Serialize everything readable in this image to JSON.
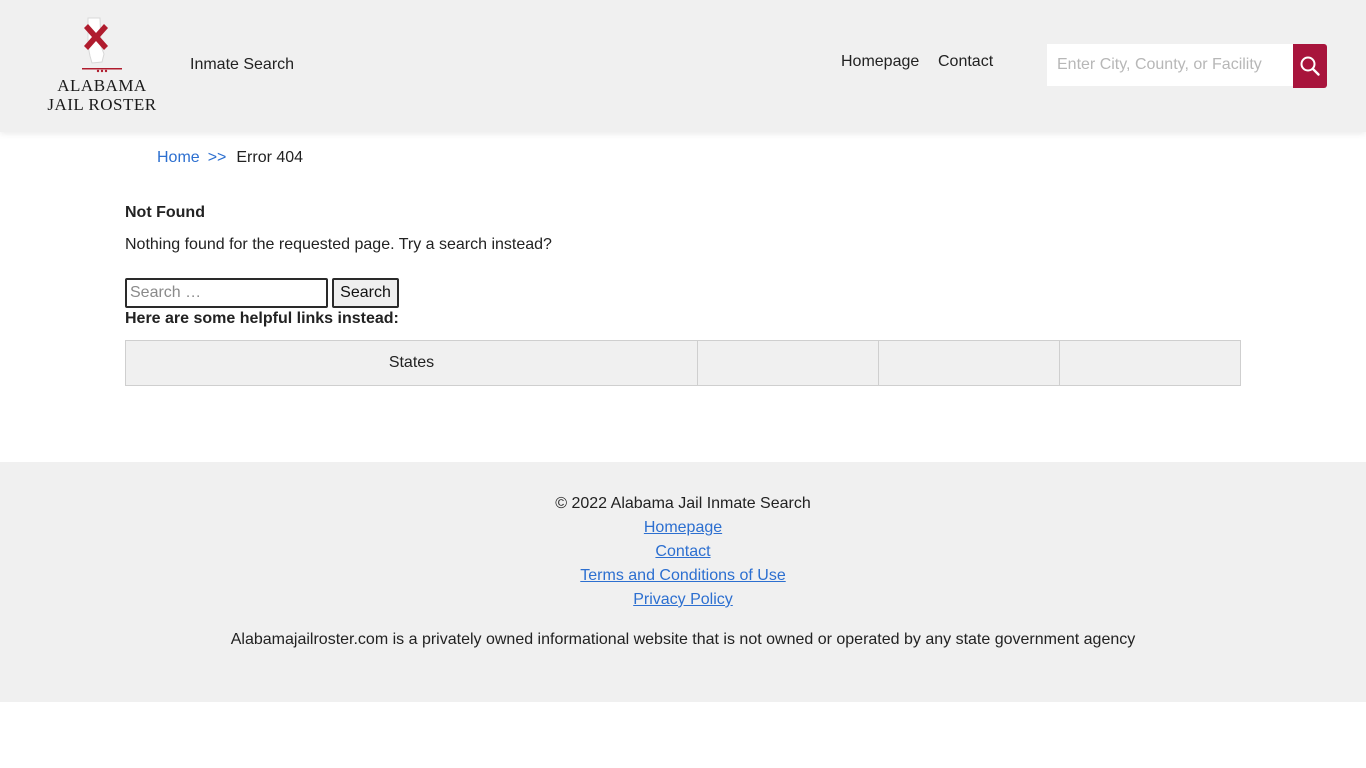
{
  "header": {
    "logo": {
      "line1": "ALABAMA",
      "line2": "JAIL ROSTER",
      "icon": "alabama-flag-state-icon",
      "accent_color": "#b01c2e"
    },
    "nav": {
      "inmate_search": "Inmate Search",
      "homepage": "Homepage",
      "contact": "Contact"
    },
    "search": {
      "placeholder": "Enter City, County, or Facility",
      "button_icon": "search-icon",
      "button_color": "#a8143c"
    }
  },
  "breadcrumb": {
    "home": "Home",
    "separator": ">>",
    "current": "Error 404"
  },
  "main": {
    "title": "Not Found",
    "message": "Nothing found for the requested page. Try a search instead?",
    "search": {
      "placeholder": "Search …",
      "button_label": "Search"
    },
    "helpful_heading": "Here are some helpful links instead:",
    "links_table": {
      "cells": [
        "States",
        "",
        "",
        ""
      ]
    }
  },
  "footer": {
    "copyright": "© 2022 Alabama Jail Inmate Search",
    "links": [
      "Homepage",
      "Contact",
      "Terms and Conditions of Use",
      "Privacy Policy"
    ],
    "disclaimer": "Alabamajailroster.com is a privately owned informational website that is not owned or operated by any state government agency",
    "link_color": "#2c6fd0"
  }
}
